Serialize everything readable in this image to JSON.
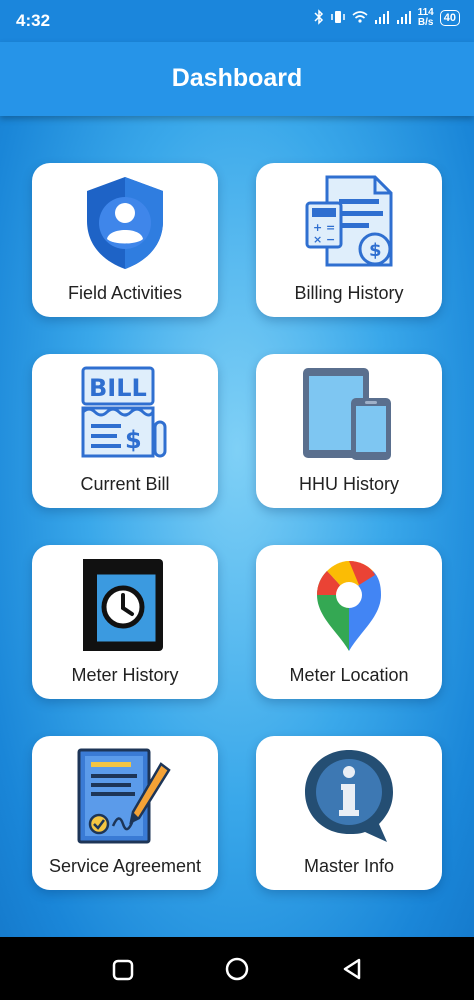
{
  "status_bar": {
    "time": "4:32",
    "net_speed_value": "114",
    "net_speed_unit": "B/s",
    "battery": "40"
  },
  "app_bar": {
    "title": "Dashboard"
  },
  "tiles": [
    {
      "label": "Field Activities",
      "icon": "shield-user-icon"
    },
    {
      "label": "Billing History",
      "icon": "invoice-calculator-icon"
    },
    {
      "label": "Current Bill",
      "icon": "bill-icon"
    },
    {
      "label": "HHU History",
      "icon": "tablet-phone-icon"
    },
    {
      "label": "Meter History",
      "icon": "clock-book-icon"
    },
    {
      "label": "Meter Location",
      "icon": "map-pin-icon"
    },
    {
      "label": "Service Agreement",
      "icon": "contract-pen-icon"
    },
    {
      "label": "Master Info",
      "icon": "info-bubble-icon"
    }
  ],
  "colors": {
    "app_bar": "#2694e8",
    "status_bar": "#1b86dc",
    "background": "#3aa8ea",
    "card": "#ffffff"
  }
}
